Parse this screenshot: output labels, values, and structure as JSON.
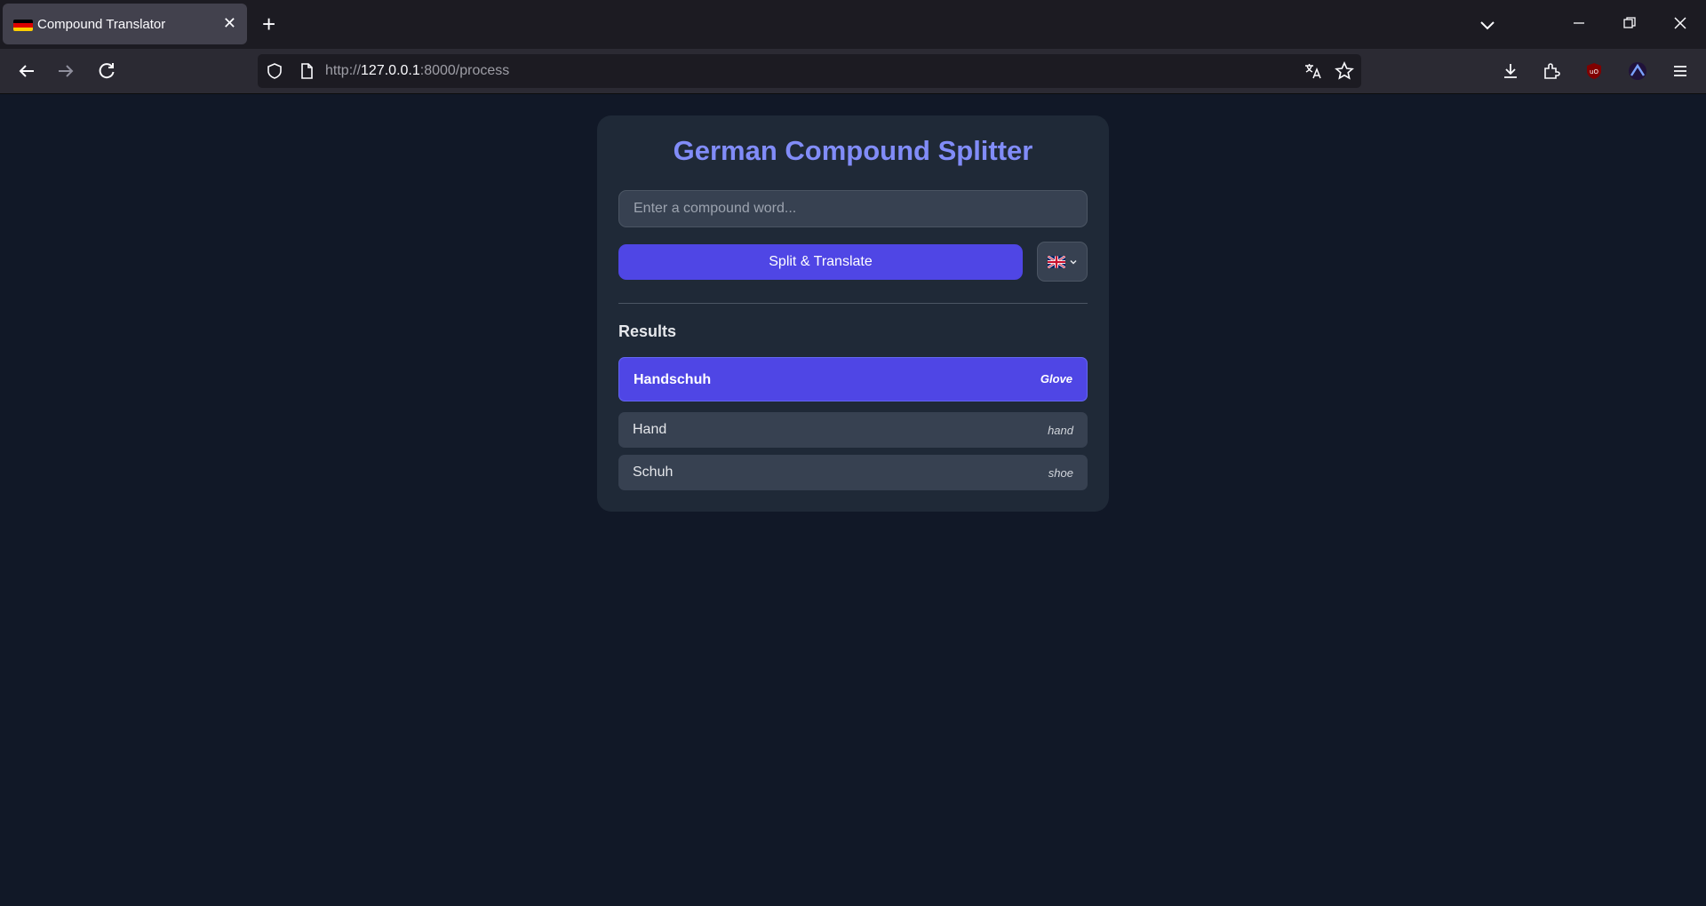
{
  "browser": {
    "tab": {
      "title": "Compound Translator",
      "close": "✕"
    },
    "new_tab": "+",
    "url": {
      "scheme": "http://",
      "host": "127.0.0.1",
      "rest": ":8000/process"
    }
  },
  "app": {
    "title": "German Compound Splitter",
    "input": {
      "placeholder": "Enter a compound word...",
      "value": ""
    },
    "submit_label": "Split & Translate",
    "language": {
      "selected": "English",
      "flag_icon": "uk-flag-icon"
    },
    "results_heading": "Results",
    "result_main": {
      "word": "Handschuh",
      "translation": "Glove"
    },
    "parts": [
      {
        "word": "Hand",
        "translation": "hand"
      },
      {
        "word": "Schuh",
        "translation": "shoe"
      }
    ]
  },
  "colors": {
    "page_bg": "#111827",
    "card_bg": "#1f2937",
    "accent": "#4f46e5",
    "title": "#818cf8"
  }
}
